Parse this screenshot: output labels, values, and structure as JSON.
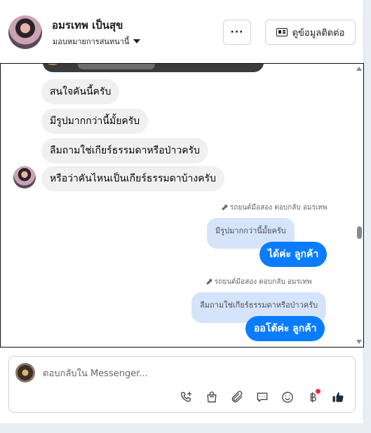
{
  "header": {
    "name": "อมรเทพ เป็นสุข",
    "role": "มอบหมายการสนทนานี้",
    "more_label": "···",
    "contact_label": "ดูข้อมูลติดต่อ"
  },
  "messages": {
    "incoming": [
      "สนใจคันนี้ครับ",
      "มีรูปมากกว่านี้มั้ยครับ",
      "ลืมถามใช่เกียร์ธรรมดาหรือป่าวครับ",
      "หรือว่าคันไหนเป็นเกียร์ธรรมดาบ้างครับ"
    ],
    "replies": [
      {
        "label": "รถยนต์มือสอง ตอบกลับ อมรเทพ",
        "quoted": "มีรูปมากกว่านี้มั้ยครับ",
        "text": "ได้ค่ะ ลูกค้า"
      },
      {
        "label": "รถยนต์มือสอง ตอบกลับ อมรเทพ",
        "quoted": "ลืมถามใช่เกียร์ธรรมดาหรือป่าวครับ",
        "text": "ออโต้ค่ะ ลูกค้า"
      }
    ]
  },
  "composer": {
    "placeholder": "ตอบกลับใน Messenger..."
  },
  "icons": {
    "phone": "phone-plus-icon",
    "bag": "shopping-bag-icon",
    "attach": "paperclip-icon",
    "saved": "chat-bubble-icon",
    "emoji": "smiley-icon",
    "currency": "baht-icon",
    "like": "thumbs-up-icon"
  },
  "colors": {
    "outgoing": "#0a7cff",
    "quoted": "#d6e4fb",
    "incoming": "#f0f0f0",
    "badge": "#f02849"
  }
}
